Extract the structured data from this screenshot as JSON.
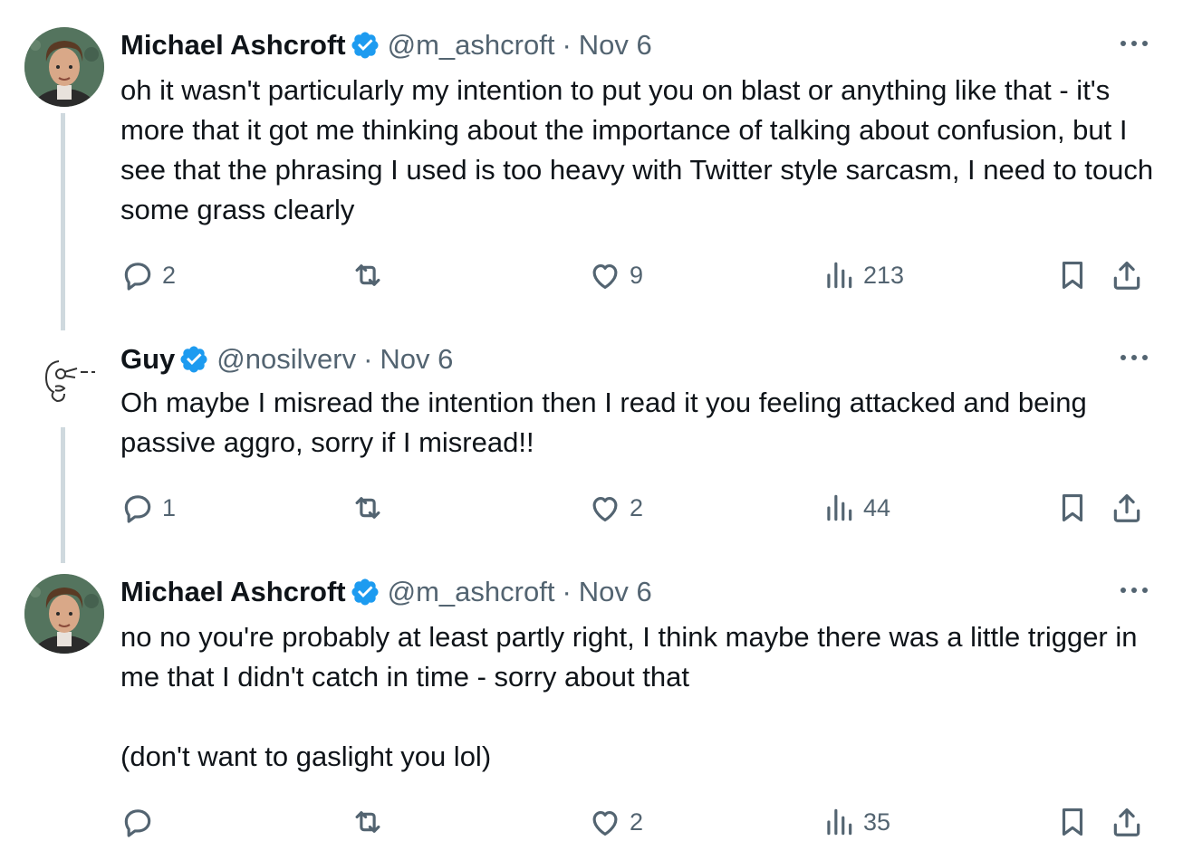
{
  "tweets": [
    {
      "author_name": "Michael Ashcroft",
      "handle": "@m_ashcroft",
      "separator": "·",
      "date": "Nov 6",
      "text_lines": [
        "oh it wasn't particularly my intention to put you on blast or anything like that - it's more that it got me thinking about the importance of talking about confusion, but I see that the phrasing I used is too heavy with Twitter style sarcasm, I need to touch some grass clearly"
      ],
      "replies": "2",
      "retweets": "",
      "likes": "9",
      "views": "213"
    },
    {
      "author_name": "Guy",
      "handle": "@nosilverv",
      "separator": "·",
      "date": "Nov 6",
      "text_lines": [
        "Oh maybe I misread the intention then I read it you feeling attacked and being passive aggro, sorry if I misread!!"
      ],
      "replies": "1",
      "retweets": "",
      "likes": "2",
      "views": "44"
    },
    {
      "author_name": "Michael Ashcroft",
      "handle": "@m_ashcroft",
      "separator": "·",
      "date": "Nov 6",
      "text_lines": [
        "no no you're probably at least partly right, I think maybe there was a little trigger in me that I didn't catch in time - sorry about that",
        "(don't want to gaslight you lol)"
      ],
      "replies": "",
      "retweets": "",
      "likes": "2",
      "views": "35"
    }
  ],
  "icons": {
    "verified": "verified-badge-icon",
    "more": "more-horizontal-icon",
    "reply": "reply-icon",
    "retweet": "retweet-icon",
    "like": "heart-icon",
    "views": "views-chart-icon",
    "bookmark": "bookmark-icon",
    "share": "share-icon"
  },
  "colors": {
    "verified_blue": "#1d9bf0",
    "secondary_text": "#536471",
    "primary_text": "#0f1419",
    "thread_line": "#cfd9de"
  }
}
